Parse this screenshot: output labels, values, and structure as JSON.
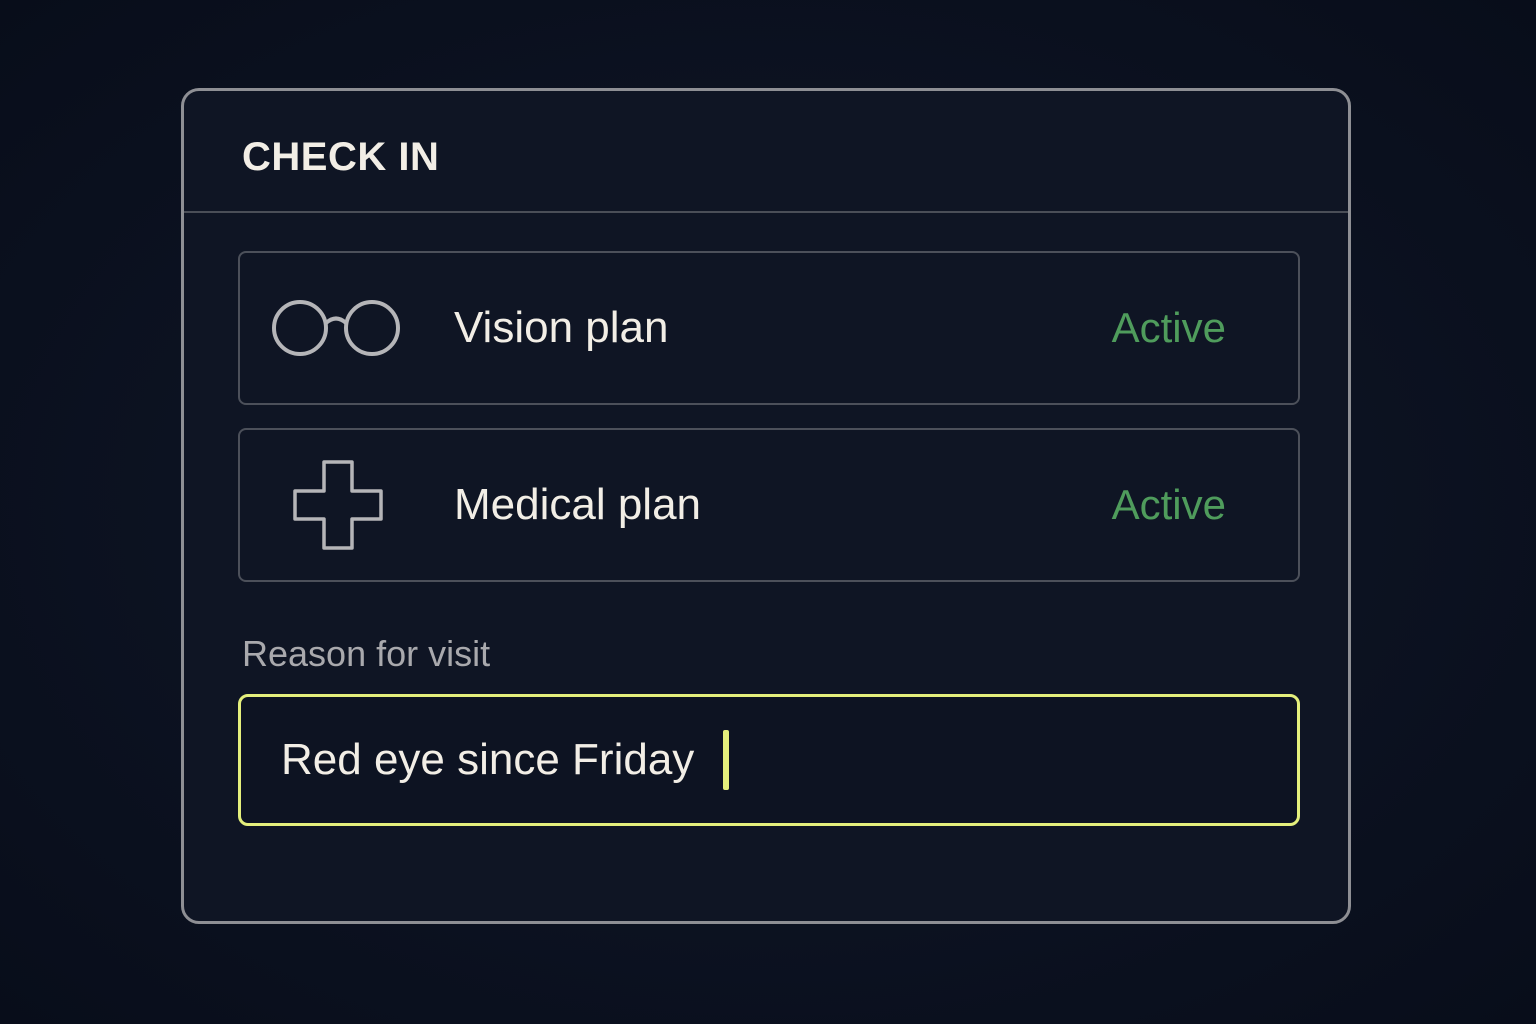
{
  "dialog": {
    "title": "CHECK IN"
  },
  "plans": [
    {
      "name": "Vision plan",
      "status": "Active",
      "icon": "glasses-icon"
    },
    {
      "name": "Medical plan",
      "status": "Active",
      "icon": "medical-cross-icon"
    }
  ],
  "reason": {
    "label": "Reason for visit",
    "value": "Red eye since Friday "
  },
  "colors": {
    "background": "#0c1221",
    "panel_border": "#8e8f94",
    "status_active": "#4f9c5c",
    "focus_accent": "#e4ef7c",
    "text_primary": "#f2eee6",
    "text_muted": "#a9a9ad"
  }
}
